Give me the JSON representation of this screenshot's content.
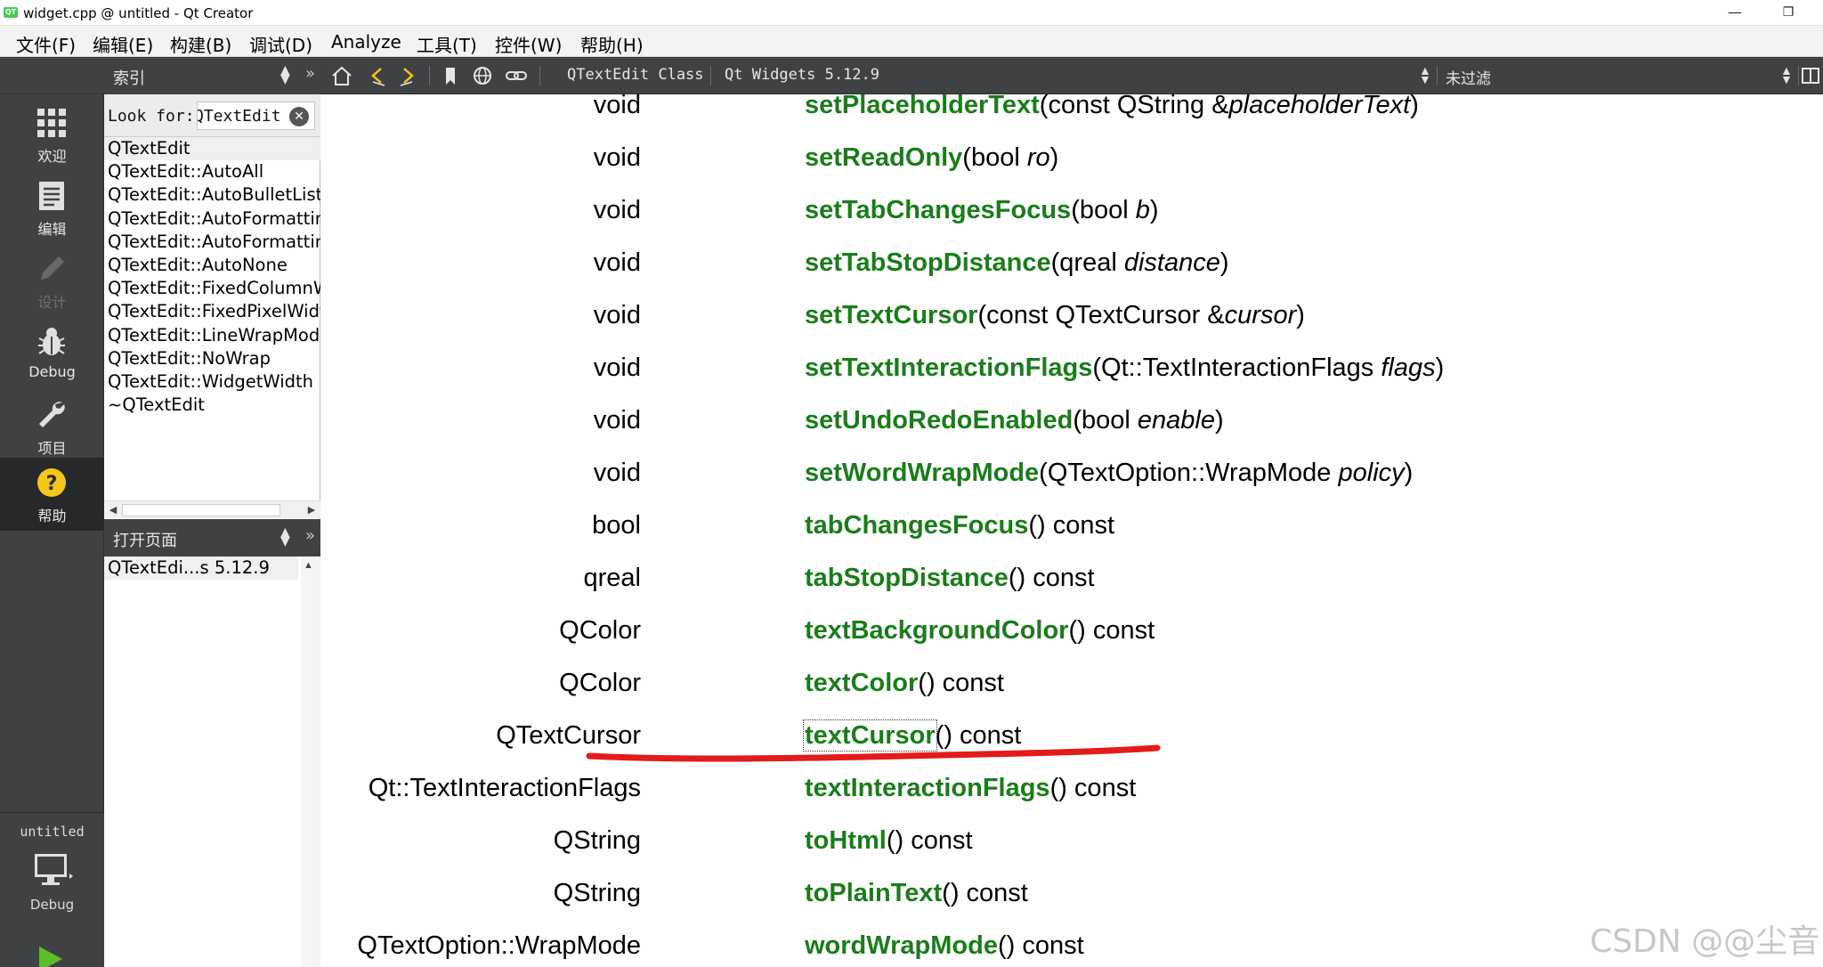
{
  "window": {
    "title": "widget.cpp @ untitled - Qt Creator",
    "app_icon": "QT",
    "minimize_glyph": "—",
    "restore_glyph": "❐"
  },
  "menubar": [
    "文件(F)",
    "编辑(E)",
    "构建(B)",
    "调试(D)",
    "Analyze",
    "工具(T)",
    "控件(W)",
    "帮助(H)"
  ],
  "modes": [
    {
      "label": "欢迎",
      "icon": "grid-icon",
      "enabled": true,
      "active": false
    },
    {
      "label": "编辑",
      "icon": "document-icon",
      "enabled": true,
      "active": false
    },
    {
      "label": "设计",
      "icon": "pencil-icon",
      "enabled": false,
      "active": false
    },
    {
      "label": "Debug",
      "icon": "bug-icon",
      "enabled": true,
      "active": false
    },
    {
      "label": "项目",
      "icon": "wrench-icon",
      "enabled": true,
      "active": false
    },
    {
      "label": "帮助",
      "icon": "help-icon",
      "enabled": true,
      "active": true
    }
  ],
  "kit": {
    "project": "untitled",
    "config": "Debug",
    "icon": "monitor-icon"
  },
  "index_panel": {
    "title": "索引",
    "look_for_label": "Look for:",
    "search_value": "QTextEdit",
    "items": [
      "QTextEdit",
      "QTextEdit::AutoAll",
      "QTextEdit::AutoBulletList",
      "QTextEdit::AutoFormattin",
      "QTextEdit::AutoFormattin",
      "QTextEdit::AutoNone",
      "QTextEdit::FixedColumnW",
      "QTextEdit::FixedPixelWidt",
      "QTextEdit::LineWrapMode",
      "QTextEdit::NoWrap",
      "QTextEdit::WidgetWidth",
      "~QTextEdit"
    ],
    "selected_index": 0
  },
  "open_pages_panel": {
    "title": "打开页面",
    "items": [
      "QTextEdi...s 5.12.9"
    ]
  },
  "doc_toolbar": {
    "page_combo": "QTextEdit Class",
    "doc_combo": "Qt Widgets 5.12.9",
    "filter_combo": "未过滤"
  },
  "doc_rows": [
    {
      "type": "void",
      "name": "setPlaceholderText",
      "pre": "(const QString &",
      "param": "placeholderText",
      "post": ")"
    },
    {
      "type": "void",
      "name": "setReadOnly",
      "pre": "(bool ",
      "param": "ro",
      "post": ")"
    },
    {
      "type": "void",
      "name": "setTabChangesFocus",
      "pre": "(bool ",
      "param": "b",
      "post": ")"
    },
    {
      "type": "void",
      "name": "setTabStopDistance",
      "pre": "(qreal ",
      "param": "distance",
      "post": ")"
    },
    {
      "type": "void",
      "name": "setTextCursor",
      "pre": "(const QTextCursor &",
      "param": "cursor",
      "post": ")"
    },
    {
      "type": "void",
      "name": "setTextInteractionFlags",
      "pre": "(Qt::TextInteractionFlags ",
      "param": "flags",
      "post": ")"
    },
    {
      "type": "void",
      "name": "setUndoRedoEnabled",
      "pre": "(bool ",
      "param": "enable",
      "post": ")"
    },
    {
      "type": "void",
      "name": "setWordWrapMode",
      "pre": "(QTextOption::WrapMode ",
      "param": "policy",
      "post": ")"
    },
    {
      "type": "bool",
      "name": "tabChangesFocus",
      "pre": "() const",
      "param": "",
      "post": ""
    },
    {
      "type": "qreal",
      "name": "tabStopDistance",
      "pre": "() const",
      "param": "",
      "post": ""
    },
    {
      "type": "QColor",
      "name": "textBackgroundColor",
      "pre": "() const",
      "param": "",
      "post": ""
    },
    {
      "type": "QColor",
      "name": "textColor",
      "pre": "() const",
      "param": "",
      "post": ""
    },
    {
      "type": "QTextCursor",
      "name": "textCursor",
      "pre": "() const",
      "param": "",
      "post": "",
      "focused": true
    },
    {
      "type": "Qt::TextInteractionFlags",
      "name": "textInteractionFlags",
      "pre": "() const",
      "param": "",
      "post": ""
    },
    {
      "type": "QString",
      "name": "toHtml",
      "pre": "() const",
      "param": "",
      "post": ""
    },
    {
      "type": "QString",
      "name": "toPlainText",
      "pre": "() const",
      "param": "",
      "post": ""
    },
    {
      "type": "QTextOption::WrapMode",
      "name": "wordWrapMode",
      "pre": "() const",
      "param": "",
      "post": ""
    }
  ],
  "annotation": {
    "color": "#e31b1b"
  },
  "watermark": "CSDN @@尘音",
  "colors": {
    "function_name": "#1a7d1a",
    "mode_bar": "#3f4244",
    "help_icon": "#f5c518",
    "run_icon": "#5cbf2a"
  }
}
